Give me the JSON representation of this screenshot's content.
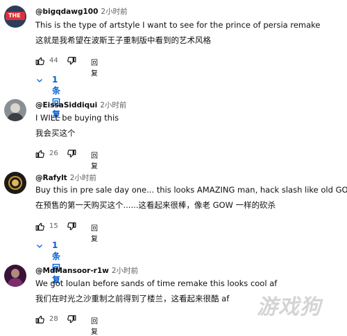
{
  "colors": {
    "accent": "#065fd4",
    "text": "#0f0f0f",
    "muted": "#606060"
  },
  "comments": [
    {
      "author": "@bigqdawg100",
      "time": "2小时前",
      "lines": [
        "This is the type of artstyle I want to see for the prince of persia remake",
        "这就是我希望在波斯王子重制版中看到的艺术风格"
      ],
      "likes": "44",
      "reply_label": "回复",
      "replies_label": "1 条回复",
      "avatar_text": "THE"
    },
    {
      "author": "@EissaSiddiqui",
      "time": "2小时前",
      "lines": [
        "I WILL be buying this",
        "我会买这个"
      ],
      "likes": "26",
      "reply_label": "回复"
    },
    {
      "author": "@Rafylt",
      "time": "2小时前",
      "lines": [
        "Buy this in pre sale day one... this looks AMAZING man, hack slash like old GOW",
        "在预售的第一天购买这个......这看起来很棒，像老 GOW 一样的砍杀"
      ],
      "likes": "15",
      "reply_label": "回复",
      "replies_label": "1 条回复"
    },
    {
      "author": "@MdMansoor-r1w",
      "time": "2小时前",
      "lines": [
        "We got loulan before sands of time remake this looks cool af",
        "我们在时光之沙重制之前得到了楼兰，这看起来很酷 af"
      ],
      "likes": "28",
      "reply_label": "回复"
    }
  ],
  "watermark": "游戏狗"
}
